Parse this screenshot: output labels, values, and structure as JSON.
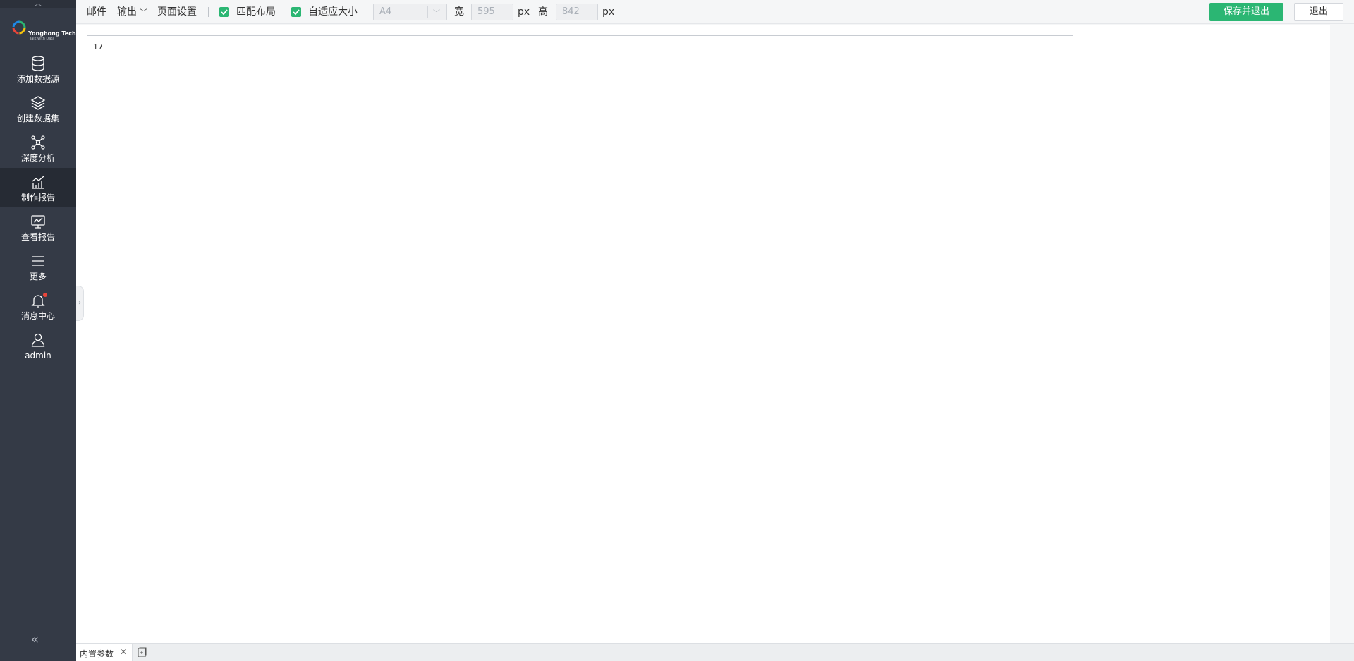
{
  "sidebar": {
    "logo": {
      "brand": "Yonghong Tech",
      "tagline": "Talk with Data"
    },
    "items": [
      {
        "label": "添加数据源",
        "icon": "database-icon"
      },
      {
        "label": "创建数据集",
        "icon": "layers-icon"
      },
      {
        "label": "深度分析",
        "icon": "network-icon"
      },
      {
        "label": "制作报告",
        "icon": "bar-chart-icon",
        "active": true
      },
      {
        "label": "查看报告",
        "icon": "monitor-chart-icon"
      },
      {
        "label": "更多",
        "icon": "menu-icon"
      },
      {
        "label": "消息中心",
        "icon": "bell-icon",
        "badge": true
      },
      {
        "label": "admin",
        "icon": "user-icon"
      }
    ]
  },
  "toolbar": {
    "mail_label": "邮件",
    "output_label": "输出",
    "page_setup_label": "页面设置",
    "match_layout_label": "匹配布局",
    "auto_fit_label": "自适应大小",
    "paper_size": "A4",
    "width_label": "宽",
    "width_value": "595",
    "width_unit": "px",
    "height_label": "高",
    "height_value": "842",
    "height_unit": "px",
    "save_exit_label": "保存并退出",
    "exit_label": "退出"
  },
  "canvas": {
    "text_value": "17"
  },
  "bottom": {
    "tab_label": "内置参数"
  },
  "colors": {
    "sidebar_bg": "#343a46",
    "sidebar_active_bg": "#262b34",
    "accent_green": "#2bb673",
    "notification_red": "#e9453a"
  }
}
